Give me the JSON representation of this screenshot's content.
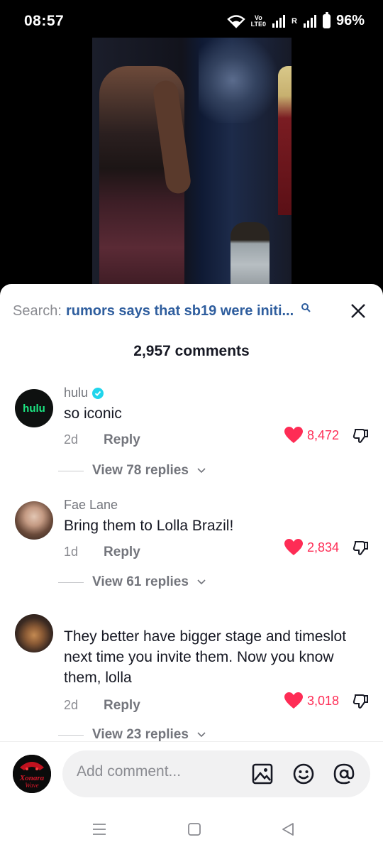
{
  "status_bar": {
    "time": "08:57",
    "volte_top": "Vo",
    "volte_bottom": "LTE0",
    "roaming": "R",
    "battery": "96%"
  },
  "search": {
    "label": "Search:",
    "term": "rumors says that sb19 were initi..."
  },
  "comments_count": "2,957 comments",
  "comments": [
    {
      "user": "hulu",
      "verified": true,
      "avatar_text": "hulu",
      "text": "so iconic",
      "age": "2d",
      "reply_label": "Reply",
      "likes": "8,472",
      "replies": "View 78 replies"
    },
    {
      "user": "Fae Lane",
      "verified": false,
      "text": "Bring them to Lolla Brazil!",
      "age": "1d",
      "reply_label": "Reply",
      "likes": "2,834",
      "replies": "View 61 replies"
    },
    {
      "user": "",
      "verified": false,
      "text": "They better have bigger stage and timeslot next time you invite them. Now you know them, lolla",
      "age": "2d",
      "reply_label": "Reply",
      "likes": "3,018",
      "replies": "View 23 replies"
    }
  ],
  "input": {
    "placeholder": "Add comment...",
    "avatar_text": "Xonara Wave"
  },
  "colors": {
    "accent": "#fe2c55",
    "search_term": "#2f5e9e",
    "verified": "#20d5ec"
  },
  "icons": [
    "wifi-icon",
    "signal-icon",
    "battery-icon",
    "search-icon",
    "close-icon",
    "verified-icon",
    "heart-icon",
    "dislike-icon",
    "image-icon",
    "emoji-icon",
    "mention-icon",
    "chevron-down-icon",
    "menu-icon",
    "home-icon",
    "back-icon"
  ]
}
